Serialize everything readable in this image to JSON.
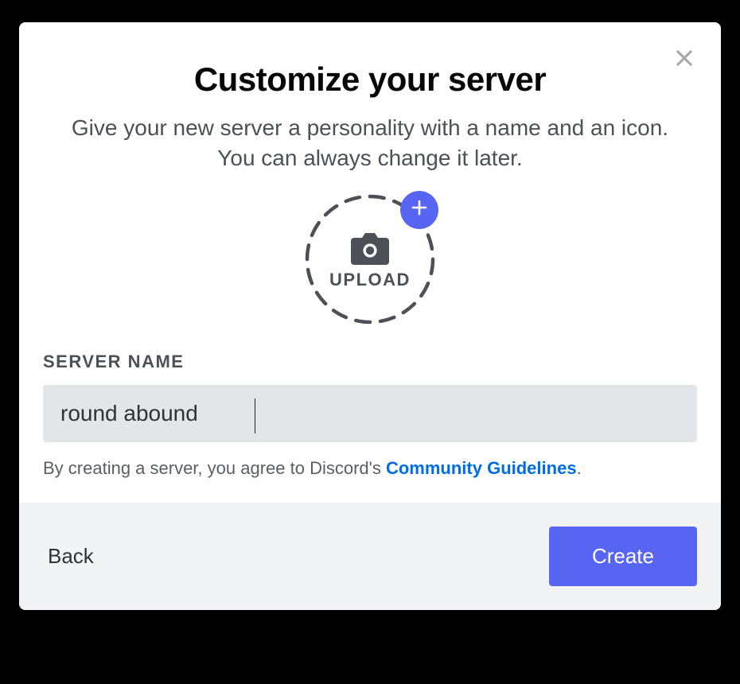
{
  "modal": {
    "title": "Customize your server",
    "subtitle": "Give your new server a personality with a name and an icon. You can always change it later.",
    "upload_label": "UPLOAD",
    "field_label": "SERVER NAME",
    "server_name_value": "round abound",
    "disclaimer_prefix": "By creating a server, you agree to Discord's ",
    "disclaimer_link": "Community Guidelines",
    "disclaimer_suffix": ".",
    "back_label": "Back",
    "create_label": "Create",
    "colors": {
      "accent": "#5865f2",
      "link": "#006ce7",
      "input_bg": "#e3e5e8",
      "footer_bg": "#f2f3f5"
    }
  }
}
